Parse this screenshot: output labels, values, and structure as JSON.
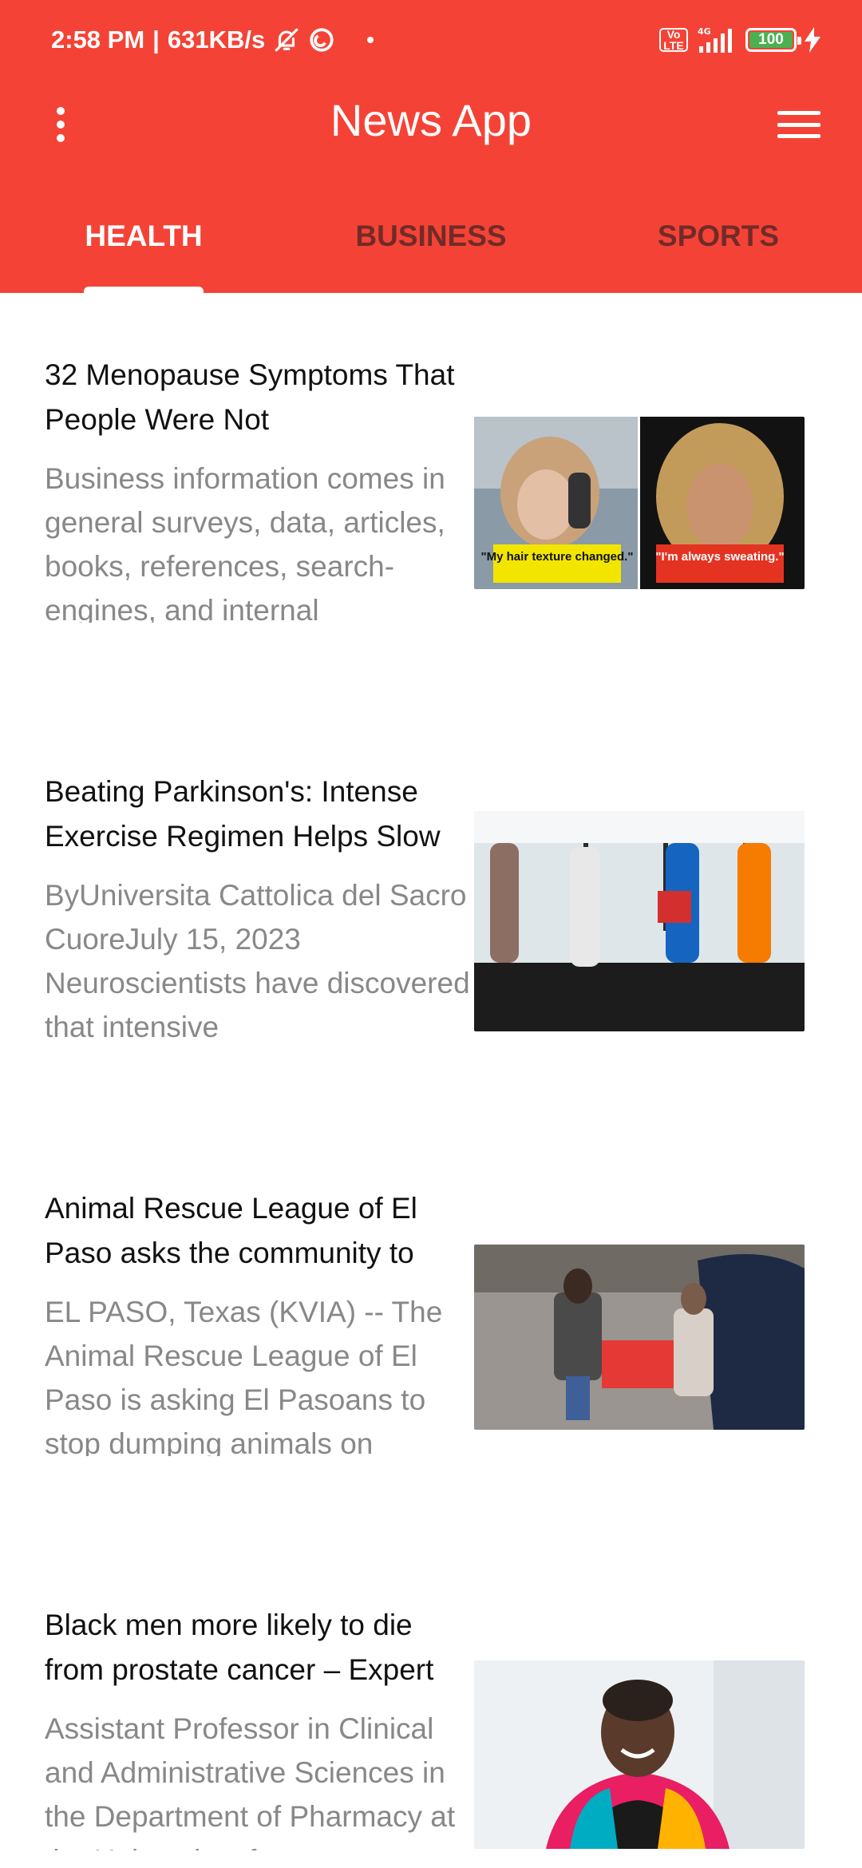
{
  "status_bar": {
    "time": "2:58 PM",
    "speed": "631KB/s",
    "network": "4G",
    "volte": "Vo LTE",
    "battery": "100"
  },
  "toolbar": {
    "title": "News App",
    "menu_icon": "more-vert-icon",
    "drawer_icon": "hamburger-icon"
  },
  "tabs": [
    {
      "label": "HEALTH",
      "active": true
    },
    {
      "label": "BUSINESS",
      "active": false
    },
    {
      "label": "SPORTS",
      "active": false
    }
  ],
  "colors": {
    "primary": "#f44336",
    "title_text": "#111111",
    "desc_text": "#888888"
  },
  "articles": [
    {
      "title": "32 Menopause Symptoms That People Were Not",
      "description": "Business information comes in general surveys, data, articles, books, references, search-engines, and internal",
      "image": {
        "caption_left": "\"My hair texture changed.\"",
        "caption_right": "\"I'm always sweating.\""
      }
    },
    {
      "title": "Beating Parkinson's: Intense Exercise Regimen Helps Slow",
      "description": "ByUniversita Cattolica del Sacro CuoreJuly 15, 2023 Neuroscientists have discovered that intensive",
      "image": {}
    },
    {
      "title": "Animal Rescue League of El Paso asks the community to",
      "description": "EL PASO, Texas (KVIA) -- The Animal Rescue League of El Paso is asking El Pasoans to stop dumping animals on",
      "image": {}
    },
    {
      "title": "Black men more likely to die from prostate cancer – Expert",
      "description": "Assistant Professor in Clinical and Administrative Sciences in the Department of Pharmacy at the University of",
      "image": {}
    }
  ]
}
